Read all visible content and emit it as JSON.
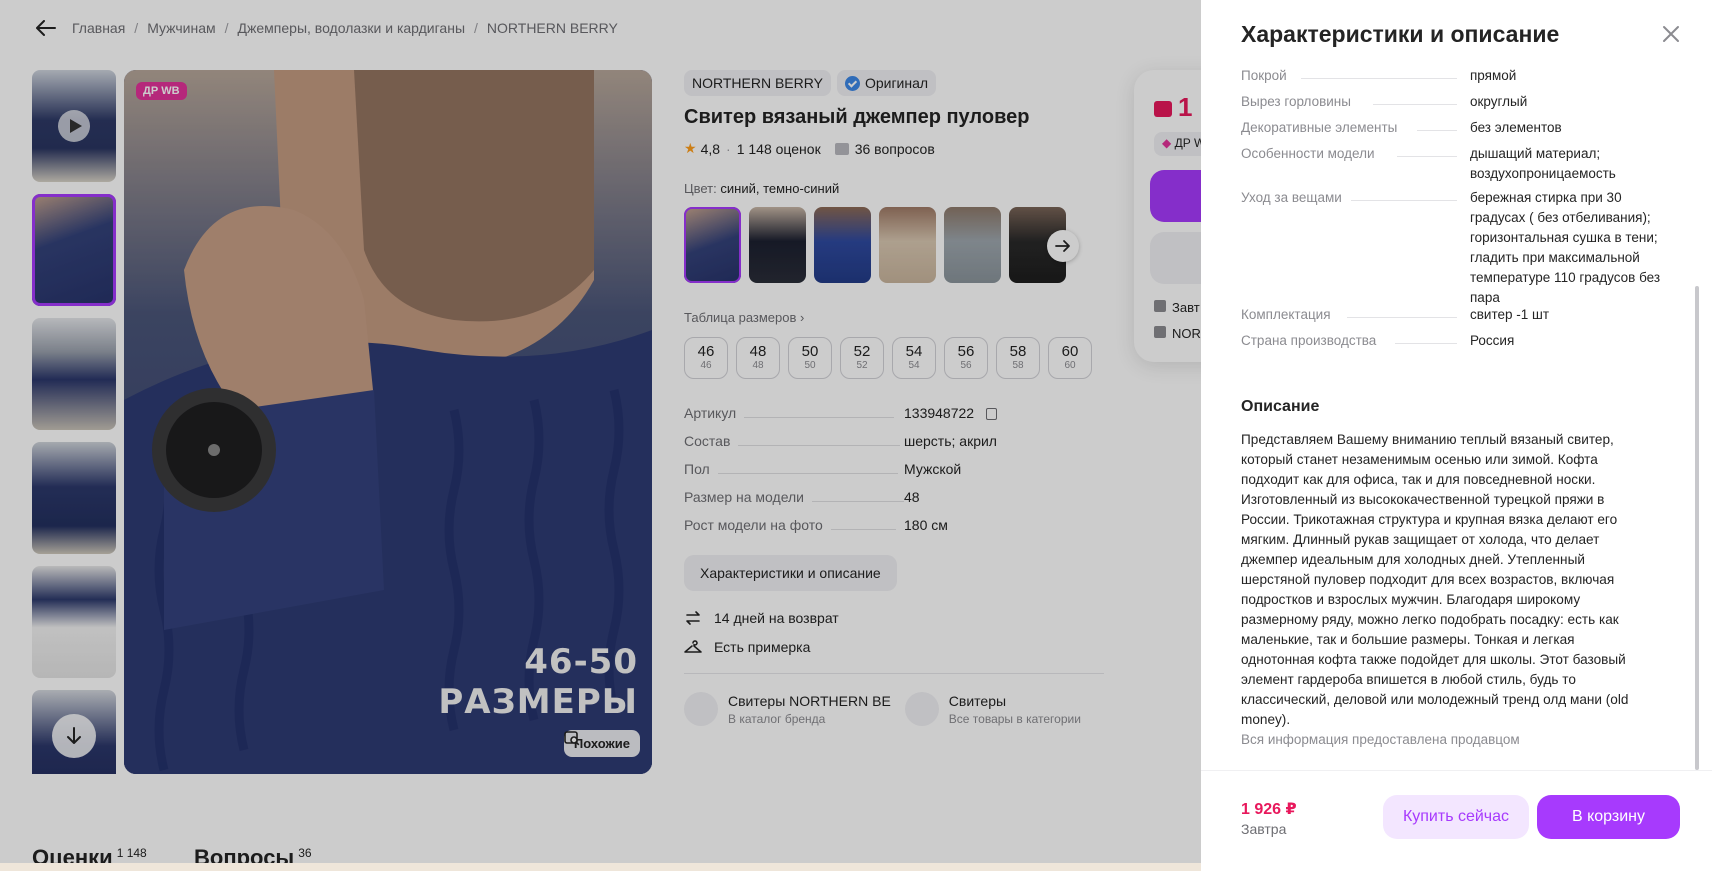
{
  "breadcrumbs": [
    "Главная",
    "Мужчинам",
    "Джемперы, водолазки и кардиганы",
    "NORTHERN BERRY"
  ],
  "gallery": {
    "badge": "ДР WB",
    "caption_line1": "46-50",
    "caption_line2": "РАЗМЕРЫ",
    "similar_label": "Похожие"
  },
  "product": {
    "brand": "NORTHERN BERRY",
    "original_label": "Оригинал",
    "title": "Свитер вязаный джемпер пуловер",
    "rating": "4,8",
    "reviews_count": "1 148 оценок",
    "questions_count": "36 вопросов",
    "color_prefix": "Цвет:",
    "color_value": "синий, темно-синий",
    "size_table_label": "Таблица размеров",
    "sizes": [
      {
        "n": "46",
        "s": "46"
      },
      {
        "n": "48",
        "s": "48"
      },
      {
        "n": "50",
        "s": "50"
      },
      {
        "n": "52",
        "s": "52"
      },
      {
        "n": "54",
        "s": "54"
      },
      {
        "n": "56",
        "s": "56"
      },
      {
        "n": "58",
        "s": "58"
      },
      {
        "n": "60",
        "s": "60"
      }
    ],
    "params": [
      {
        "k": "Артикул",
        "v": "133948722"
      },
      {
        "k": "Состав",
        "v": "шерсть; акрил"
      },
      {
        "k": "Пол",
        "v": "Мужской"
      },
      {
        "k": "Размер на модели",
        "v": "48"
      },
      {
        "k": "Рост модели на фото",
        "v": "180 см"
      }
    ],
    "char_button": "Характеристики и описание",
    "return_text": "14 дней на возврат",
    "fitting_text": "Есть примерка",
    "brand_catalog_title": "Свитеры NORTHERN BE",
    "brand_catalog_sub": "В каталог бренда",
    "category_title": "Свитеры",
    "category_sub": "Все товары в категории"
  },
  "buy_card": {
    "price_partial": "1",
    "dr_partial": "ДР W",
    "line1": "Завт",
    "line2": "NOR"
  },
  "tabs": {
    "reviews": "Оценки",
    "reviews_count": "1 148",
    "questions": "Вопросы",
    "questions_count": "36"
  },
  "panel": {
    "title": "Характеристики и описание",
    "specs": [
      {
        "k": "Покрой",
        "v": "прямой"
      },
      {
        "k": "Вырез горловины",
        "v": "округлый"
      },
      {
        "k": "Декоративные элементы",
        "v": "без элементов"
      },
      {
        "k": "Особенности модели",
        "v": "дышащий материал; воздухопроницаемость"
      },
      {
        "k": "Уход за вещами",
        "v": "бережная стирка при 30 градусах ( без отбеливания); горизонтальная сушка в тени; гладить при максимальной температуре 110 градусов без пара"
      },
      {
        "k": "Комплектация",
        "v": "свитер -1 шт"
      },
      {
        "k": "Страна производства",
        "v": "Россия"
      }
    ],
    "description_title": "Описание",
    "description": "Представляем Вашему вниманию теплый вязаный свитер, который станет незаменимым осенью или зимой. Кофта подходит как для офиса, так и для повседневной носки. Изготовленный из высококачественной турецкой пряжи в России. Трикотажная структура и крупная вязка делают его мягким. Длинный рукав защищает от холода, что делает джемпер идеальным для холодных дней. Утепленный шерстяной пуловер подходит для всех возрастов, включая подростков и взрослых мужчин. Благодаря широкому размерному ряду, можно легко подобрать посадку: есть как маленькие, так и большие размеры. Тонкая и легкая однотонная кофта также подойдет для школы. Этот базовый элемент гардероба впишется в любой стиль, будь то классический, деловой или молодежный тренд олд мани (old money).",
    "seller_note": "Вся информация предоставлена продавцом",
    "footer_price": "1 926 ₽",
    "footer_date": "Завтра",
    "buy_now": "Купить сейчас",
    "to_cart": "В корзину"
  },
  "colors": {
    "accent": "#a73afd",
    "price": "#e8185c",
    "badge": "#e3339a"
  }
}
